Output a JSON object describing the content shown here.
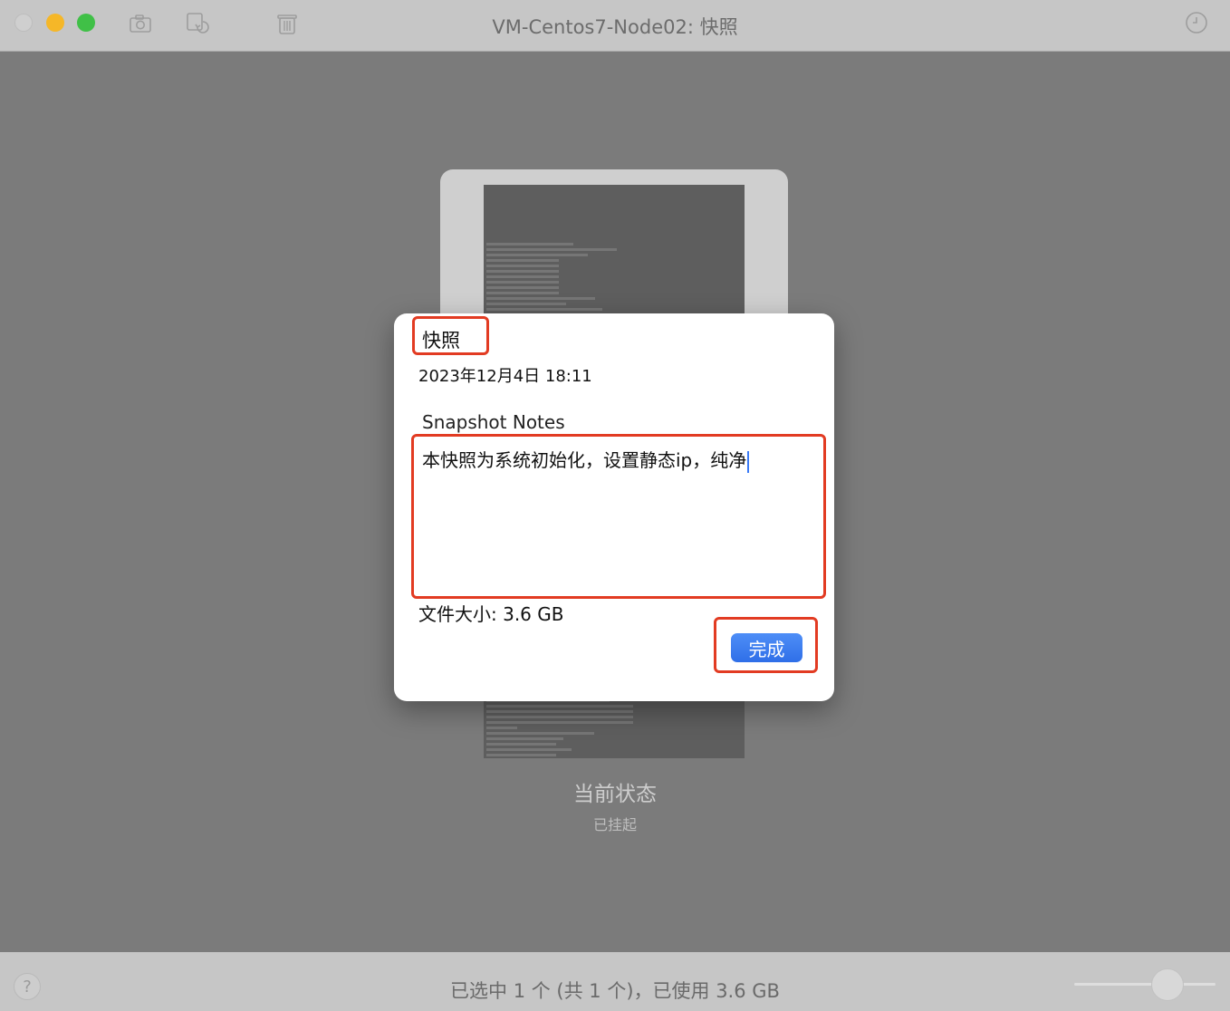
{
  "window": {
    "title": "VM-Centos7-Node02: 快照"
  },
  "toolbar": {
    "icons": [
      "camera-icon",
      "restore-snapshot-icon",
      "trash-icon"
    ],
    "right_icon": "clock-icon"
  },
  "snapshot_card": {
    "state_label": "当前状态",
    "state_sub": "已挂起"
  },
  "dialog": {
    "title": "快照",
    "date": "2023年12月4日 18:11",
    "notes_label": "Snapshot Notes",
    "notes_value": "本快照为系统初始化，设置静态ip，纯净",
    "file_size": "文件大小: 3.6 GB",
    "done_label": "完成",
    "accent_color": "#3b7bf6",
    "highlight_color": "#e23b22"
  },
  "statusbar": {
    "help_label": "?",
    "text": "已选中 1 个 (共 1 个)，已使用 3.6 GB"
  }
}
